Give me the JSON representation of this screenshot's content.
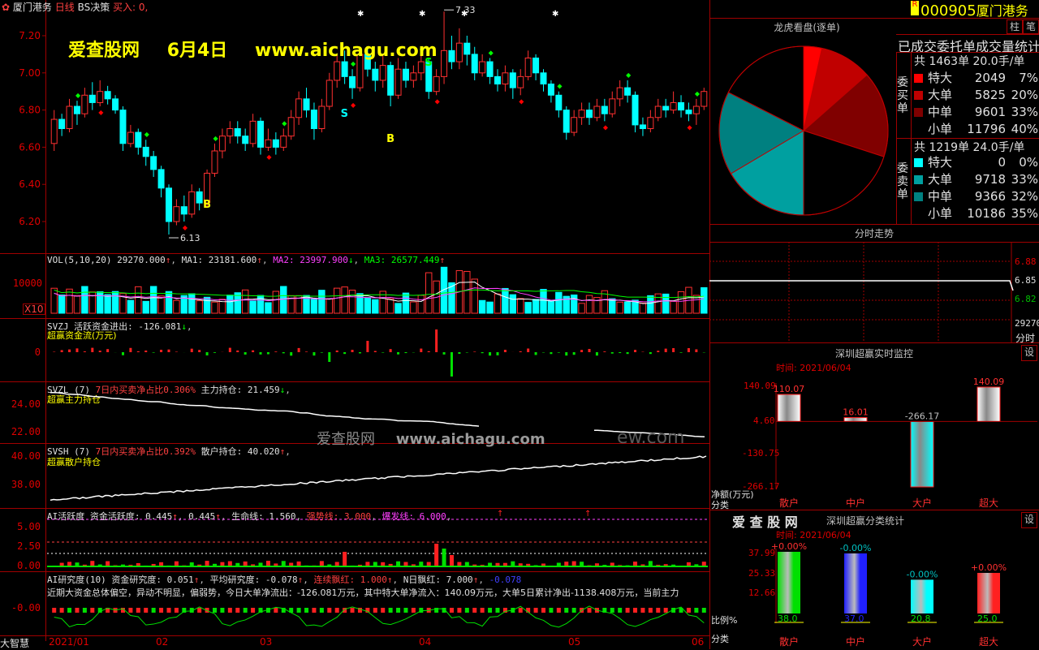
{
  "header": {
    "stock_name": "厦门港务",
    "period": "日线",
    "indicator": "BS决策",
    "buy_label": "买入: 0,",
    "code": "000905",
    "code_name": "厦门港务",
    "r_badge": "R"
  },
  "watermark": {
    "site": "爱查股网",
    "date": "6月4日",
    "url": "www.aichagu.com",
    "center_text": "爱查股网",
    "center_url": "www.aichagu.com",
    "center_suffix": "ew.com"
  },
  "main_chart": {
    "y_labels": [
      "7.20",
      "7.00",
      "6.80",
      "6.60",
      "6.40",
      "6.20"
    ],
    "high_marker": "7.33",
    "low_marker": "6.13",
    "signals": [
      "S",
      "B",
      "B",
      "S"
    ],
    "candles": [
      {
        "o": 6.62,
        "c": 6.75,
        "h": 6.8,
        "l": 6.58
      },
      {
        "o": 6.75,
        "c": 6.7,
        "h": 6.78,
        "l": 6.66
      },
      {
        "o": 6.7,
        "c": 6.82,
        "h": 6.86,
        "l": 6.68
      },
      {
        "o": 6.82,
        "c": 6.78,
        "h": 6.85,
        "l": 6.72
      },
      {
        "o": 6.78,
        "c": 6.88,
        "h": 6.92,
        "l": 6.76
      },
      {
        "o": 6.88,
        "c": 6.84,
        "h": 6.95,
        "l": 6.8
      },
      {
        "o": 6.84,
        "c": 6.9,
        "h": 6.96,
        "l": 6.82
      },
      {
        "o": 6.9,
        "c": 6.86,
        "h": 6.93,
        "l": 6.83
      },
      {
        "o": 6.86,
        "c": 6.8,
        "h": 6.88,
        "l": 6.78
      },
      {
        "o": 6.8,
        "c": 6.62,
        "h": 6.82,
        "l": 6.58
      },
      {
        "o": 6.62,
        "c": 6.68,
        "h": 6.72,
        "l": 6.6
      },
      {
        "o": 6.68,
        "c": 6.6,
        "h": 6.7,
        "l": 6.56
      },
      {
        "o": 6.6,
        "c": 6.55,
        "h": 6.64,
        "l": 6.5
      },
      {
        "o": 6.55,
        "c": 6.48,
        "h": 6.58,
        "l": 6.44
      },
      {
        "o": 6.48,
        "c": 6.38,
        "h": 6.5,
        "l": 6.33
      },
      {
        "o": 6.38,
        "c": 6.2,
        "h": 6.4,
        "l": 6.13
      },
      {
        "o": 6.2,
        "c": 6.28,
        "h": 6.32,
        "l": 6.18
      },
      {
        "o": 6.28,
        "c": 6.24,
        "h": 6.34,
        "l": 6.2
      },
      {
        "o": 6.24,
        "c": 6.36,
        "h": 6.4,
        "l": 6.22
      },
      {
        "o": 6.36,
        "c": 6.3,
        "h": 6.38,
        "l": 6.26
      },
      {
        "o": 6.3,
        "c": 6.46,
        "h": 6.48,
        "l": 6.28
      },
      {
        "o": 6.46,
        "c": 6.58,
        "h": 6.62,
        "l": 6.44
      },
      {
        "o": 6.58,
        "c": 6.66,
        "h": 6.7,
        "l": 6.54
      },
      {
        "o": 6.66,
        "c": 6.7,
        "h": 6.74,
        "l": 6.62
      },
      {
        "o": 6.7,
        "c": 6.66,
        "h": 6.74,
        "l": 6.62
      },
      {
        "o": 6.66,
        "c": 6.62,
        "h": 6.7,
        "l": 6.58
      },
      {
        "o": 6.62,
        "c": 6.74,
        "h": 6.78,
        "l": 6.6
      },
      {
        "o": 6.74,
        "c": 6.6,
        "h": 6.76,
        "l": 6.56
      },
      {
        "o": 6.6,
        "c": 6.64,
        "h": 6.7,
        "l": 6.58
      },
      {
        "o": 6.64,
        "c": 6.6,
        "h": 6.68,
        "l": 6.56
      },
      {
        "o": 6.6,
        "c": 6.66,
        "h": 6.7,
        "l": 6.58
      },
      {
        "o": 6.66,
        "c": 6.76,
        "h": 6.8,
        "l": 6.64
      },
      {
        "o": 6.76,
        "c": 6.86,
        "h": 6.9,
        "l": 6.72
      },
      {
        "o": 6.86,
        "c": 6.8,
        "h": 6.92,
        "l": 6.76
      },
      {
        "o": 6.8,
        "c": 6.7,
        "h": 6.84,
        "l": 6.64
      },
      {
        "o": 6.7,
        "c": 6.82,
        "h": 6.86,
        "l": 6.68
      },
      {
        "o": 6.82,
        "c": 6.96,
        "h": 7.0,
        "l": 6.8
      },
      {
        "o": 6.96,
        "c": 7.06,
        "h": 7.1,
        "l": 6.92
      },
      {
        "o": 7.06,
        "c": 6.98,
        "h": 7.12,
        "l": 6.94
      },
      {
        "o": 6.98,
        "c": 6.92,
        "h": 7.02,
        "l": 6.86
      },
      {
        "o": 6.92,
        "c": 7.1,
        "h": 7.14,
        "l": 6.9
      },
      {
        "o": 7.1,
        "c": 7.02,
        "h": 7.14,
        "l": 6.98
      },
      {
        "o": 7.02,
        "c": 6.96,
        "h": 7.06,
        "l": 6.9
      },
      {
        "o": 6.96,
        "c": 7.04,
        "h": 7.1,
        "l": 6.92
      },
      {
        "o": 7.04,
        "c": 6.88,
        "h": 7.06,
        "l": 6.82
      },
      {
        "o": 6.88,
        "c": 7.02,
        "h": 7.08,
        "l": 6.86
      },
      {
        "o": 7.02,
        "c": 6.96,
        "h": 7.06,
        "l": 6.92
      },
      {
        "o": 6.96,
        "c": 7.0,
        "h": 7.04,
        "l": 6.92
      },
      {
        "o": 7.0,
        "c": 7.06,
        "h": 7.1,
        "l": 6.96
      },
      {
        "o": 7.06,
        "c": 6.9,
        "h": 7.08,
        "l": 6.86
      },
      {
        "o": 6.9,
        "c": 6.98,
        "h": 7.02,
        "l": 6.88
      },
      {
        "o": 6.98,
        "c": 7.12,
        "h": 7.33,
        "l": 6.94
      },
      {
        "o": 7.12,
        "c": 7.06,
        "h": 7.2,
        "l": 7.02
      },
      {
        "o": 7.06,
        "c": 7.16,
        "h": 7.24,
        "l": 7.02
      },
      {
        "o": 7.16,
        "c": 7.1,
        "h": 7.2,
        "l": 7.04
      },
      {
        "o": 7.1,
        "c": 7.0,
        "h": 7.14,
        "l": 6.96
      },
      {
        "o": 7.0,
        "c": 7.06,
        "h": 7.1,
        "l": 6.98
      },
      {
        "o": 7.06,
        "c": 6.98,
        "h": 7.08,
        "l": 6.94
      },
      {
        "o": 6.98,
        "c": 6.94,
        "h": 7.02,
        "l": 6.9
      },
      {
        "o": 6.94,
        "c": 7.0,
        "h": 7.04,
        "l": 6.9
      },
      {
        "o": 7.0,
        "c": 6.92,
        "h": 7.02,
        "l": 6.86
      },
      {
        "o": 6.92,
        "c": 6.98,
        "h": 7.02,
        "l": 6.88
      },
      {
        "o": 6.98,
        "c": 7.08,
        "h": 7.12,
        "l": 6.96
      },
      {
        "o": 7.08,
        "c": 7.0,
        "h": 7.1,
        "l": 6.96
      },
      {
        "o": 7.0,
        "c": 6.94,
        "h": 7.02,
        "l": 6.9
      },
      {
        "o": 6.94,
        "c": 6.88,
        "h": 6.96,
        "l": 6.84
      },
      {
        "o": 6.88,
        "c": 6.8,
        "h": 6.9,
        "l": 6.76
      },
      {
        "o": 6.8,
        "c": 6.68,
        "h": 6.82,
        "l": 6.64
      },
      {
        "o": 6.68,
        "c": 6.76,
        "h": 6.8,
        "l": 6.66
      },
      {
        "o": 6.76,
        "c": 6.8,
        "h": 6.84,
        "l": 6.72
      },
      {
        "o": 6.8,
        "c": 6.76,
        "h": 6.84,
        "l": 6.72
      },
      {
        "o": 6.76,
        "c": 6.82,
        "h": 6.86,
        "l": 6.74
      },
      {
        "o": 6.82,
        "c": 6.78,
        "h": 6.86,
        "l": 6.74
      },
      {
        "o": 6.78,
        "c": 6.86,
        "h": 6.9,
        "l": 6.76
      },
      {
        "o": 6.86,
        "c": 6.92,
        "h": 6.96,
        "l": 6.82
      },
      {
        "o": 6.92,
        "c": 6.88,
        "h": 6.96,
        "l": 6.84
      },
      {
        "o": 6.88,
        "c": 6.72,
        "h": 6.9,
        "l": 6.68
      },
      {
        "o": 6.72,
        "c": 6.7,
        "h": 6.76,
        "l": 6.66
      },
      {
        "o": 6.7,
        "c": 6.76,
        "h": 6.8,
        "l": 6.68
      },
      {
        "o": 6.76,
        "c": 6.82,
        "h": 6.86,
        "l": 6.74
      },
      {
        "o": 6.82,
        "c": 6.8,
        "h": 6.86,
        "l": 6.76
      },
      {
        "o": 6.8,
        "c": 6.84,
        "h": 6.9,
        "l": 6.78
      },
      {
        "o": 6.84,
        "c": 6.8,
        "h": 6.88,
        "l": 6.76
      },
      {
        "o": 6.8,
        "c": 6.78,
        "h": 6.84,
        "l": 6.74
      },
      {
        "o": 6.78,
        "c": 6.82,
        "h": 6.86,
        "l": 6.72
      },
      {
        "o": 6.82,
        "c": 6.9,
        "h": 6.92,
        "l": 6.8
      }
    ]
  },
  "vol_panel": {
    "title": "VOL(5,10,20)",
    "vol": "29270.000",
    "ma1": "MA1: 23181.600",
    "ma2": "MA2: 23997.900",
    "ma3": "MA3: 26577.449",
    "y_label": "10000",
    "unit": "X10"
  },
  "svzj_panel": {
    "title": "SVZJ",
    "value": "活跃资金进出: -126.081",
    "subtitle": "超赢资金流(万元)",
    "y_label": "0"
  },
  "svzl_panel": {
    "title": "SVZL (7)",
    "ratio": "7日内买卖净占比0.306%",
    "value": "主力持仓: 21.459",
    "subtitle": "超赢主力持仓",
    "y_labels": [
      "24.00",
      "22.00"
    ]
  },
  "svsh_panel": {
    "title": "SVSH (7)",
    "ratio": "7日内买卖净占比0.392%",
    "value": "散户持仓: 40.020",
    "subtitle": "超赢散户持仓",
    "y_labels": [
      "40.00",
      "38.00"
    ]
  },
  "ai_active_panel": {
    "title": "AI活跃度",
    "value1": "资金活跃度: 0.445",
    "value2": "0.445",
    "lifeline": "生命线: 1.560",
    "strong": "强势线: 3.000",
    "burst": "爆发线: 6.000",
    "y_labels": [
      "5.00",
      "2.50",
      "0.00"
    ]
  },
  "ai_research_panel": {
    "title": "AI研究度(10)",
    "fund": "资金研究度: 0.051",
    "avg": "平均研究度: -0.078",
    "consec": "连续飘红: 1.000",
    "nday": "N日飘红: 7.000",
    "last": "-0.078",
    "comment": "近期大资金总体偏空，异动不明显，偏弱势，今日大单净流出：-126.081万元，其中特大单净流入：140.09万元，大单5日累计净出-1138.408万元，当前主力",
    "y_label": "-0.00",
    "corner": "大智慧"
  },
  "x_axis": {
    "labels": [
      "2021/01",
      "02",
      "03",
      "04",
      "05",
      "06"
    ]
  },
  "right_panel": {
    "lhb_title": "龙虎看盘(逐单)",
    "tab_zhu": "柱",
    "tab_bi": "笔",
    "stat_title": "已成交委托单成交量统计",
    "buy_side": "委买单",
    "sell_side": "委卖单",
    "buy_total": "共 1463单 20.0手/单",
    "sell_total": "共 1219单 24.0手/单",
    "buy_rows": [
      {
        "label": "特大",
        "count": "2049",
        "pct": "7%",
        "color": "#ff0000"
      },
      {
        "label": "大单",
        "count": "5825",
        "pct": "20%",
        "color": "#c00000"
      },
      {
        "label": "中单",
        "count": "9601",
        "pct": "33%",
        "color": "#800000"
      },
      {
        "label": "小单",
        "count": "11796",
        "pct": "40%",
        "color": ""
      }
    ],
    "sell_rows": [
      {
        "label": "特大",
        "count": "0",
        "pct": "0%",
        "color": "#00ffff"
      },
      {
        "label": "大单",
        "count": "9718",
        "pct": "33%",
        "color": "#00a0a0"
      },
      {
        "label": "中单",
        "count": "9366",
        "pct": "32%",
        "color": "#008080"
      },
      {
        "label": "小单",
        "count": "10186",
        "pct": "35%",
        "color": ""
      }
    ],
    "pie": [
      {
        "label": "特大",
        "pct": 3.5,
        "color": "#ff0000"
      },
      {
        "label": "大单",
        "pct": 10,
        "color": "#c00000"
      },
      {
        "label": "中单",
        "pct": 16.5,
        "color": "#800000"
      },
      {
        "label": "小单",
        "pct": 20,
        "color": "#000000"
      },
      {
        "label": "特大",
        "pct": 0,
        "color": "#00ffff"
      },
      {
        "label": "大单",
        "pct": 16.5,
        "color": "#00a0a0"
      },
      {
        "label": "中单",
        "pct": 16,
        "color": "#008080"
      },
      {
        "label": "小单",
        "pct": 17.5,
        "color": "#000000"
      }
    ],
    "fenshi_title": "分时走势",
    "fenshi_y": [
      "6.88",
      "6.85",
      "6.82"
    ],
    "fenshi_extra": "29270",
    "fenshi_label": "分时",
    "realtime_title": "深圳超赢实时监控",
    "realtime_date": "时间: 2021/06/04",
    "realtime_y": [
      "140.09",
      "4.60",
      "-130.75",
      "-266.17"
    ],
    "realtime_unit": "净额(万元)",
    "realtime_cat_label": "分类",
    "realtime_bars": [
      {
        "cat": "散户",
        "value": "110.07",
        "amount": 110.07,
        "color": "#ffffff",
        "label_color": "#ff0000"
      },
      {
        "cat": "中户",
        "value": "16.01",
        "amount": 16.01,
        "color": "#ffffff",
        "label_color": "#ff0000"
      },
      {
        "cat": "大户",
        "value": "-266.17",
        "amount": -266.17,
        "color": "#00ffff",
        "label_color": "#c0c0c0"
      },
      {
        "cat": "超大",
        "value": "140.09",
        "amount": 140.09,
        "color": "#ffffff",
        "label_color": "#ff0000"
      }
    ],
    "set_label": "设",
    "class_brand": "爱 查 股 网",
    "class_title": "深圳超赢分类统计",
    "class_date": "时间: 2021/06/04",
    "class_y": [
      "37.99",
      "25.33",
      "12.66"
    ],
    "class_ratio_label": "比例%",
    "class_cat_label": "分类",
    "class_bars": [
      {
        "cat": "散户",
        "pct": "+0.00%",
        "value": "38.0",
        "ratio": 38.0,
        "color": "#00e000"
      },
      {
        "cat": "中户",
        "pct": "-0.00%",
        "value": "37.0",
        "ratio": 37.0,
        "color": "#2020ff"
      },
      {
        "cat": "大户",
        "pct": "-0.00%",
        "value": "20.8",
        "ratio": 20.8,
        "color": "#00ffff"
      },
      {
        "cat": "超大",
        "pct": "+0.00%",
        "value": "25.0",
        "ratio": 25.0,
        "color": "#ff2020"
      }
    ]
  }
}
